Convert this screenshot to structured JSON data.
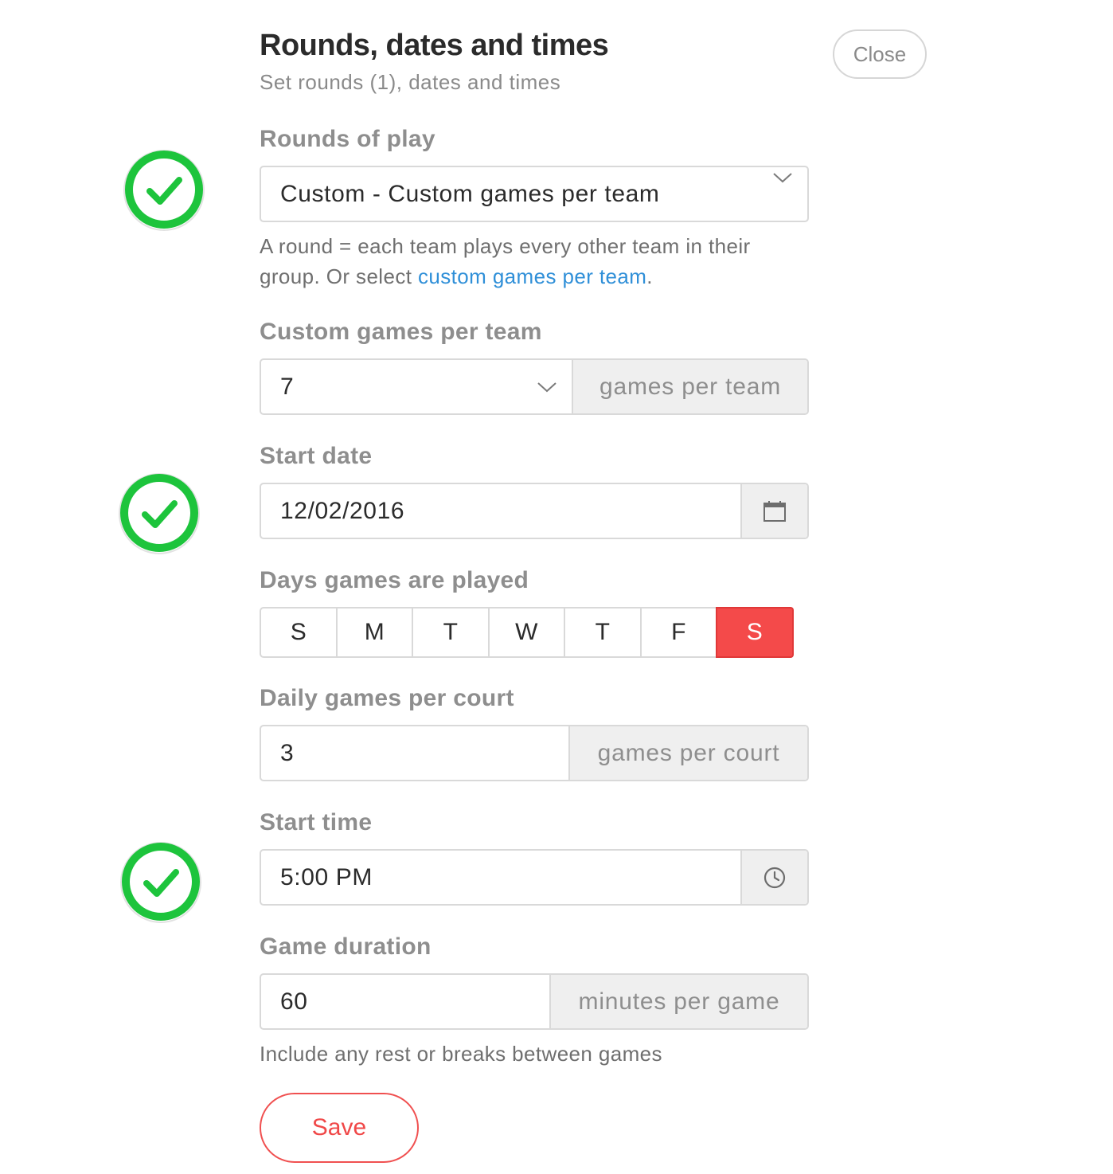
{
  "header": {
    "title": "Rounds, dates and times",
    "subtitle": "Set rounds (1), dates and times",
    "close_label": "Close"
  },
  "rounds": {
    "label": "Rounds of play",
    "value": "Custom - Custom games per team",
    "help_prefix": "A round = each team plays every other team in their",
    "help_line2": "group. Or select ",
    "help_link": "custom games per team",
    "help_suffix": "."
  },
  "custom_games": {
    "label": "Custom games per team",
    "value": "7",
    "addon": "games per team"
  },
  "start_date": {
    "label": "Start date",
    "value": "12/02/2016",
    "icon": "calendar-icon"
  },
  "days": {
    "label": "Days games are played",
    "items": [
      "S",
      "M",
      "T",
      "W",
      "T",
      "F",
      "S"
    ],
    "selected_index": 6,
    "selected_color": "#f44a4a"
  },
  "daily_games": {
    "label": "Daily games per court",
    "value": "3",
    "addon": "games per court"
  },
  "start_time": {
    "label": "Start time",
    "value": "5:00 PM",
    "icon": "clock-icon"
  },
  "duration": {
    "label": "Game duration",
    "value": "60",
    "addon": "minutes per game",
    "help": "Include any rest or breaks between games"
  },
  "save_label": "Save",
  "status": {
    "check_color": "#1dc43c",
    "checked_sections": [
      "rounds",
      "start_date",
      "start_time"
    ]
  }
}
